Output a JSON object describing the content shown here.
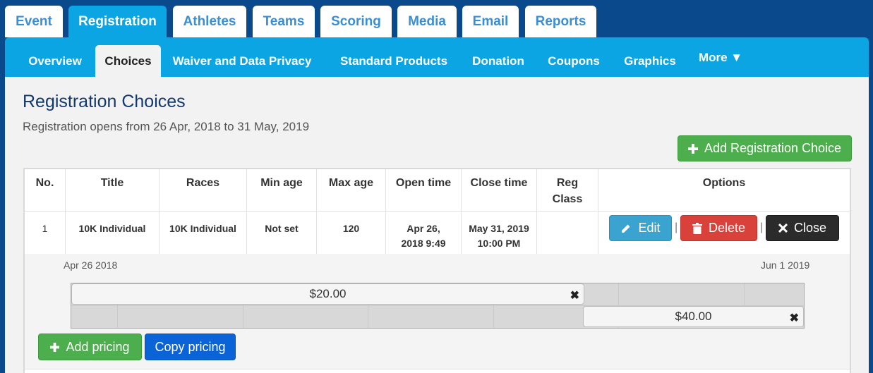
{
  "top_tabs": [
    {
      "label": "Event",
      "active": false
    },
    {
      "label": "Registration",
      "active": true
    },
    {
      "label": "Athletes",
      "active": false
    },
    {
      "label": "Teams",
      "active": false
    },
    {
      "label": "Scoring",
      "active": false
    },
    {
      "label": "Media",
      "active": false
    },
    {
      "label": "Email",
      "active": false
    },
    {
      "label": "Reports",
      "active": false
    }
  ],
  "sub_tabs": [
    {
      "label": "Overview",
      "active": false
    },
    {
      "label": "Choices",
      "active": true
    },
    {
      "label": "Waiver and Data Privacy",
      "active": false
    },
    {
      "label": "Standard Products",
      "active": false
    },
    {
      "label": "Donation",
      "active": false
    },
    {
      "label": "Coupons",
      "active": false
    },
    {
      "label": "Graphics",
      "active": false
    },
    {
      "label": "More ▼",
      "active": false
    }
  ],
  "page": {
    "title": "Registration Choices",
    "subtitle": "Registration opens from 26 Apr, 2018 to 31 May, 2019",
    "add_button": "Add Registration Choice"
  },
  "table": {
    "headers": [
      "No.",
      "Title",
      "Races",
      "Min age",
      "Max age",
      "Open time",
      "Close time",
      "Reg Class",
      "Options"
    ],
    "rows": [
      {
        "no": "1",
        "title": "10K Individual",
        "races": "10K Individual",
        "min_age": "Not set",
        "max_age": "120",
        "open_time": "Apr 26, 2018 9:49 AM",
        "close_time": "May 31, 2019 10:00 PM",
        "reg_class": ""
      }
    ],
    "options": {
      "edit": "Edit",
      "delete": "Delete",
      "close": "Close",
      "separator": "|"
    }
  },
  "pricing": {
    "start_date": "Apr 26 2018",
    "end_date": "Jun 1 2019",
    "tiers": [
      {
        "price": "$20.00"
      },
      {
        "price": "$40.00"
      }
    ],
    "remove_glyph": "✖",
    "add_pricing": "Add pricing",
    "copy_pricing": "Copy pricing"
  },
  "colors": {
    "page_bg": "#0a4a8c",
    "active_tab": "#0aa5e2",
    "tab_text": "#3a8ed6",
    "title": "#12386e",
    "success": "#4cae4c",
    "info": "#3aa3cf",
    "danger": "#d9413b",
    "dark": "#2b2b2b",
    "primary": "#0a64d8"
  },
  "icons": {
    "add": "plus-icon",
    "edit": "pencil-icon",
    "delete": "trash-icon",
    "close": "close-icon",
    "remove_tier": "remove-icon"
  }
}
